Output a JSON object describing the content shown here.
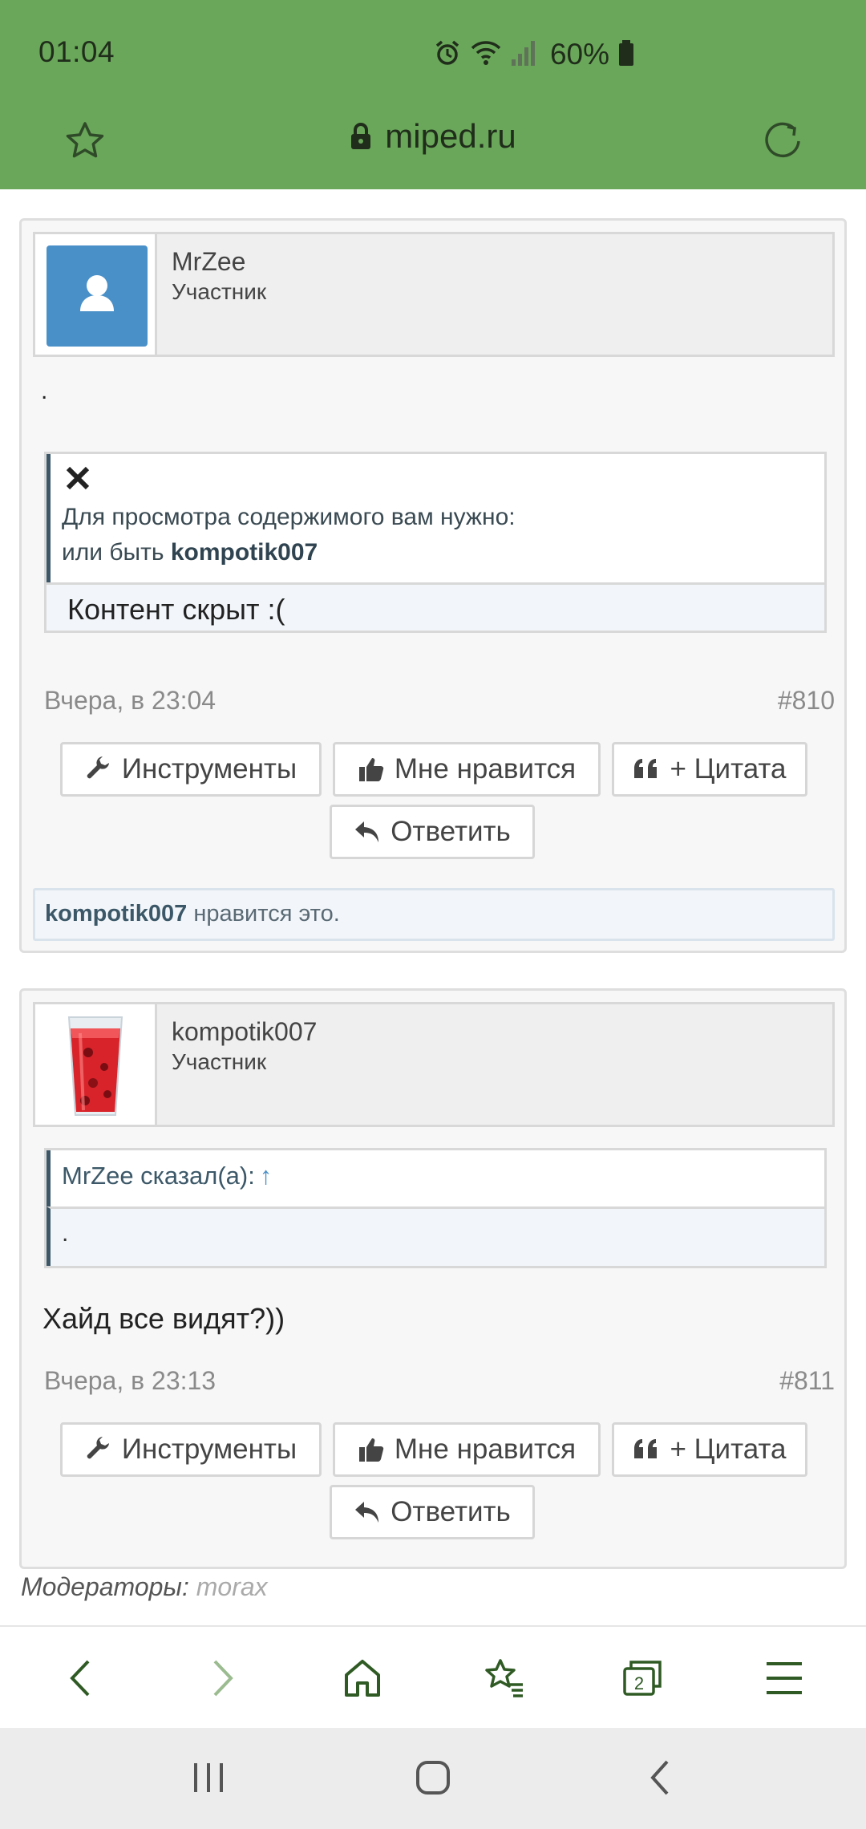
{
  "status": {
    "time": "01:04",
    "battery": "60%"
  },
  "browser": {
    "url": "miped.ru"
  },
  "posts": [
    {
      "author": "MrZee",
      "role": "Участник",
      "text": ".",
      "hidden": {
        "line1": "Для просмотра содержимого вам нужно:",
        "line2_prefix": "или быть",
        "line2_user": "kompotik007",
        "content": "Контент скрыт :("
      },
      "date": "Вчера, в 23:04",
      "number": "#810",
      "likes": {
        "user": "kompotik007",
        "suffix": "нравится это."
      }
    },
    {
      "author": "kompotik007",
      "role": "Участник",
      "quote": {
        "header": "MrZee сказал(а):",
        "arrow": "↑",
        "body": "."
      },
      "text": "Хайд все видят?))",
      "date": "Вчера, в 23:13",
      "number": "#811"
    }
  ],
  "actions": {
    "tools": "Инструменты",
    "like": "Мне нравится",
    "quote": "+ Цитата",
    "reply": "Ответить"
  },
  "moderators": {
    "label": "Модераторы:",
    "name": "morax"
  },
  "colors": {
    "bar": "#6aa75a",
    "avatar": "#4a90c8",
    "accent": "#3c5868"
  }
}
